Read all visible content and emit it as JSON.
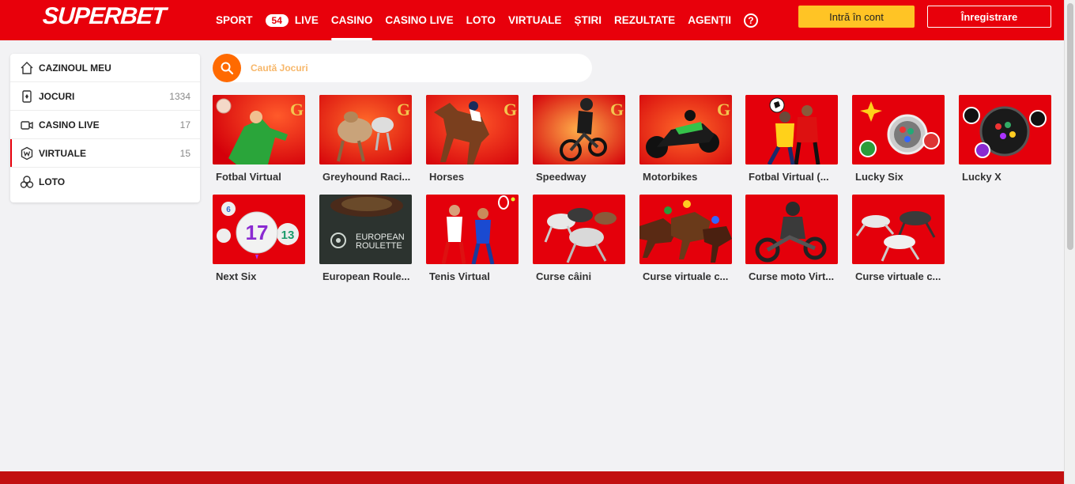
{
  "brand": {
    "name": "SUPERBET",
    "accent": "#e8000b",
    "search_accent": "#ff6a00"
  },
  "nav": {
    "sport": "SPORT",
    "live_count": "54",
    "live": "LIVE",
    "casino": "CASINO",
    "casino_live": "CASINO LIVE",
    "loto": "LOTO",
    "virtuale": "VIRTUALE",
    "stiri": "ȘTIRI",
    "rezultate": "REZULTATE",
    "agentii": "AGENȚII",
    "help": "?"
  },
  "auth": {
    "login": "Intră în cont",
    "register": "Înregistrare"
  },
  "sidebar": {
    "items": [
      {
        "label": "CAZINOUL MEU",
        "count": "",
        "icon": "home-icon"
      },
      {
        "label": "JOCURI",
        "count": "1334",
        "icon": "cards-icon"
      },
      {
        "label": "CASINO LIVE",
        "count": "17",
        "icon": "camera-icon"
      },
      {
        "label": "VIRTUALE",
        "count": "15",
        "icon": "virtual-icon",
        "active": true
      },
      {
        "label": "LOTO",
        "count": "",
        "icon": "loto-balls-icon"
      }
    ]
  },
  "search": {
    "placeholder": "Caută Jocuri"
  },
  "games": [
    {
      "title": "Fotbal Virtual"
    },
    {
      "title": "Greyhound Raci..."
    },
    {
      "title": "Horses"
    },
    {
      "title": "Speedway"
    },
    {
      "title": "Motorbikes"
    },
    {
      "title": "Fotbal Virtual (..."
    },
    {
      "title": "Lucky Six"
    },
    {
      "title": "Lucky X"
    },
    {
      "title": "Next Six"
    },
    {
      "title": "European Roule..."
    },
    {
      "title": "Tenis Virtual"
    },
    {
      "title": "Curse câini"
    },
    {
      "title": "Curse virtuale c..."
    },
    {
      "title": "Curse moto Virt..."
    },
    {
      "title": "Curse virtuale c..."
    }
  ],
  "thumb_text": {
    "next_six_number_left": "6",
    "next_six_number_main": "17",
    "next_six_number_right": "13",
    "roulette_line1": "EUROPEAN",
    "roulette_line2": "ROULETTE"
  }
}
